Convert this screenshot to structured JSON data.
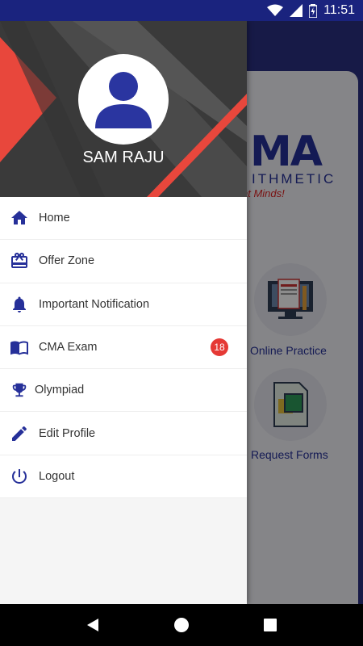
{
  "status_bar": {
    "time": "11:51",
    "icons": [
      "wifi-icon",
      "signal-icon",
      "battery-icon"
    ]
  },
  "background": {
    "brand": "MA",
    "brand_sub": "ITHMETIC",
    "brand_tagline": "at Minds!",
    "tiles": [
      {
        "label": "Online Practice",
        "icon": "monitor-document-icon"
      },
      {
        "label": "Request Forms",
        "icon": "form-document-icon"
      }
    ]
  },
  "drawer": {
    "user": {
      "name": "SAM RAJU",
      "avatar": "person-icon"
    },
    "items": [
      {
        "label": "Home",
        "icon": "home-icon"
      },
      {
        "label": "Offer Zone",
        "icon": "gift-card-icon"
      },
      {
        "label": "Important Notification",
        "icon": "bell-icon"
      },
      {
        "label": "CMA Exam",
        "icon": "book-icon",
        "badge": "18"
      },
      {
        "label": "Olympiad",
        "icon": "trophy-icon"
      },
      {
        "label": "Edit Profile",
        "icon": "pencil-icon"
      },
      {
        "label": "Logout",
        "icon": "power-icon"
      }
    ]
  },
  "nav_bar": {
    "buttons": [
      "back-icon",
      "home-circle-icon",
      "recents-icon"
    ]
  },
  "colors": {
    "primary": "#263099",
    "header_dark": "#3c3c3c",
    "accent_red": "#e8473c",
    "badge": "#e53935"
  }
}
